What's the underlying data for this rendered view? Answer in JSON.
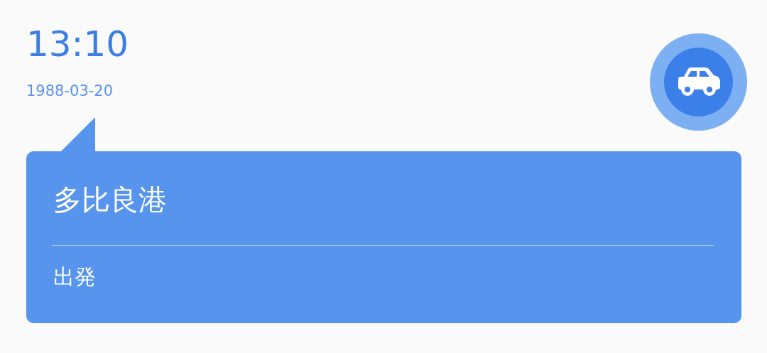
{
  "time": "13:10",
  "date": "1988-03-20",
  "card": {
    "title": "多比良港",
    "subtitle": "出発"
  }
}
